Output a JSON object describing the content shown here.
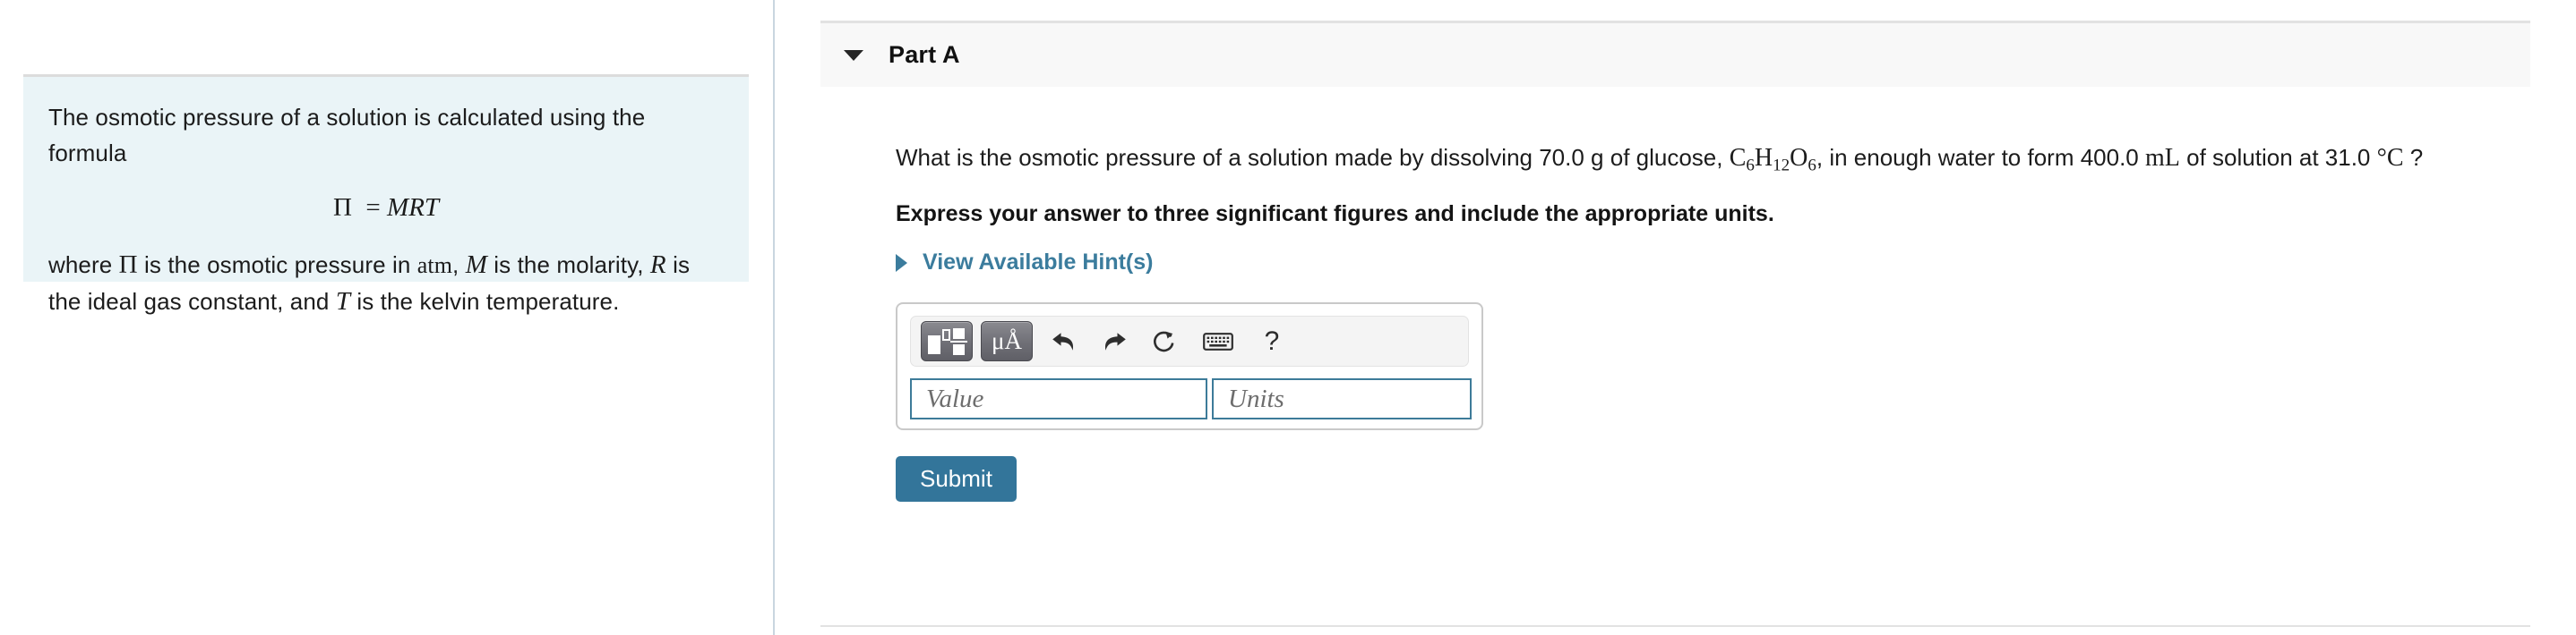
{
  "left_panel": {
    "intro_text": "The osmotic pressure of a solution is calculated using the formula",
    "equation": "Π = MRT",
    "where_prefix": "where",
    "where_pi": "Π",
    "where_mid1": "is the osmotic pressure in",
    "where_atm": "atm",
    "where_comma1": ",",
    "where_m": "M",
    "where_mid2": "is the molarity,",
    "where_r": "R",
    "where_mid3": "is the ideal gas constant, and",
    "where_t": "T",
    "where_mid4": "is the kelvin temperature.",
    "background_color": "#eaf4f7"
  },
  "part_header": {
    "title": "Part A",
    "caret_icon": "triangle-down-icon",
    "background_color": "#f8f8f8"
  },
  "question": {
    "prompt_part1": "What is the osmotic pressure of a solution made by dissolving 70.0 g of glucose,",
    "formula_c": "C",
    "formula_c_sub": "6",
    "formula_h": "H",
    "formula_h_sub": "12",
    "formula_o": "O",
    "formula_o_sub": "6",
    "prompt_part2": ", in enough water to form 400.0",
    "volume_unit": "mL",
    "prompt_part3": "of solution at 31.0",
    "temperature": "°C",
    "prompt_end": "?",
    "instruction": "Express your answer to three significant figures and include the appropriate units.",
    "hint_link": "View Available Hint(s)",
    "hint_caret_icon": "triangle-right-icon",
    "hint_color": "#3b7c9d"
  },
  "answer_widget": {
    "toolbar": {
      "template_button": "math-template-button",
      "template_icon": "math-template-icon",
      "symbols_button_label": "μÅ",
      "undo_icon": "undo-arrow-icon",
      "redo_icon": "redo-arrow-icon",
      "reset_icon": "reset-circular-arrow-icon",
      "keyboard_icon": "keyboard-icon",
      "help_label": "?"
    },
    "value_placeholder": "Value",
    "value_text": "",
    "units_placeholder": "Units",
    "units_text": "",
    "input_border_color": "#3d7b99"
  },
  "submit": {
    "label": "Submit",
    "color": "#33759a"
  }
}
